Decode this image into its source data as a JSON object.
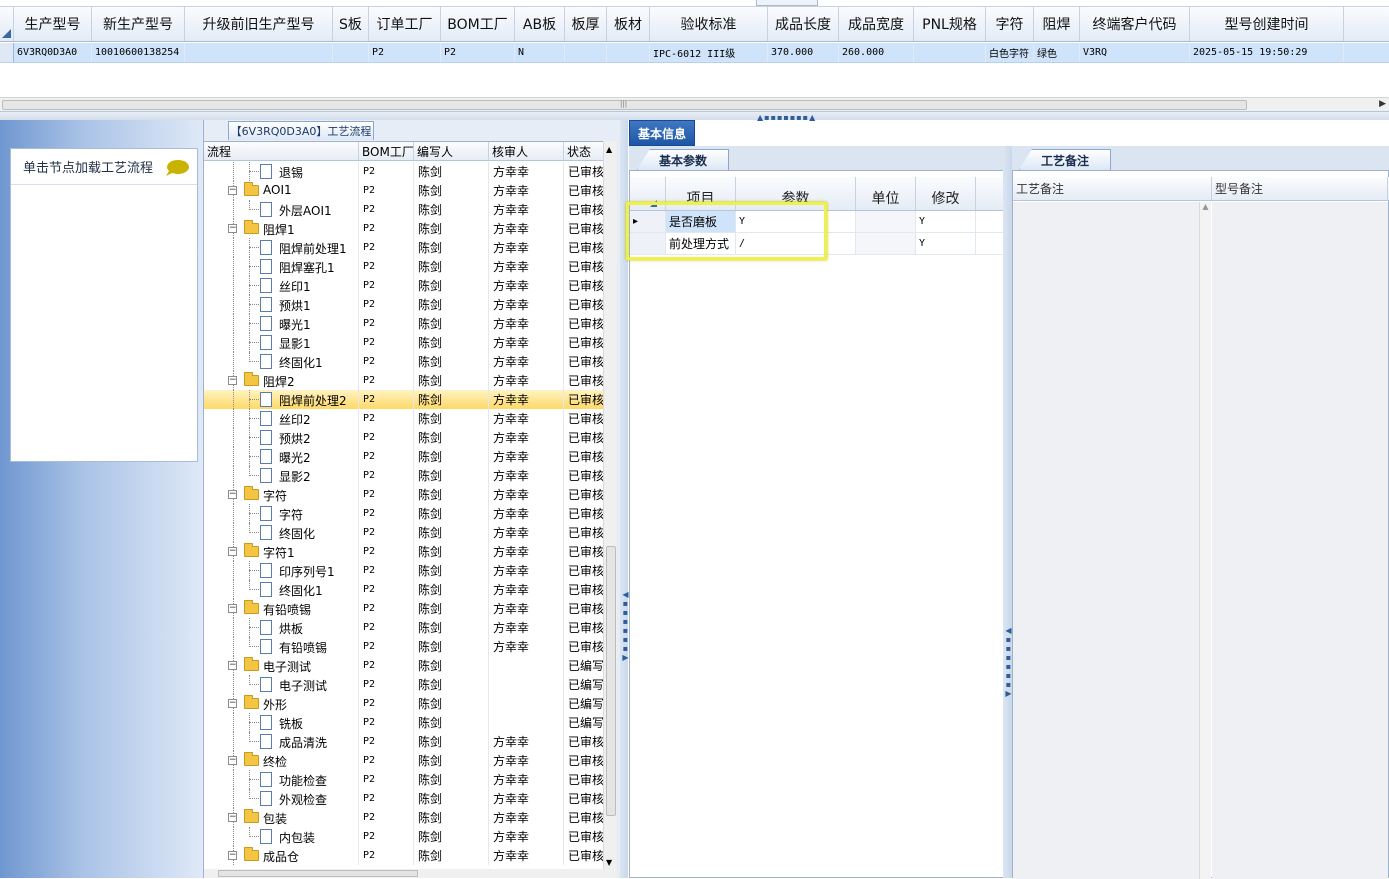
{
  "top_grid": {
    "columns": [
      "生产型号",
      "新生产型号",
      "升级前旧生产型号",
      "S板",
      "订单工厂",
      "BOM工厂",
      "AB板",
      "板厚",
      "板材",
      "验收标准",
      "成品长度",
      "成品宽度",
      "PNL规格",
      "字符",
      "阻焊",
      "终端客户代码",
      "型号创建时间"
    ],
    "row": [
      "6V3RQ0D3A0",
      "10010600138254",
      "",
      "",
      "P2",
      "P2",
      "N",
      "",
      "",
      "IPC-6012 III级",
      "370.000",
      "260.000",
      "",
      "白色字符",
      "绿色",
      "V3RQ",
      "2025-05-15 19:50:29"
    ]
  },
  "left_panel": {
    "hint": "单击节点加载工艺流程"
  },
  "tree": {
    "title": "【6V3RQ0D3A0】工艺流程",
    "columns": [
      "流程",
      "BOM工厂",
      "编写人",
      "核审人",
      "状态"
    ],
    "rows": [
      {
        "name": "退锡",
        "factory": "P2",
        "writer": "陈剑",
        "reviewer": "方幸幸",
        "status": "已审核"
      },
      {
        "name": "AOI1",
        "factory": "P2",
        "writer": "陈剑",
        "reviewer": "方幸幸",
        "status": "已审核"
      },
      {
        "name": "外层AOI1",
        "factory": "P2",
        "writer": "陈剑",
        "reviewer": "方幸幸",
        "status": "已审核"
      },
      {
        "name": "阻焊1",
        "factory": "P2",
        "writer": "陈剑",
        "reviewer": "方幸幸",
        "status": "已审核"
      },
      {
        "name": "阻焊前处理1",
        "factory": "P2",
        "writer": "陈剑",
        "reviewer": "方幸幸",
        "status": "已审核"
      },
      {
        "name": "阻焊塞孔1",
        "factory": "P2",
        "writer": "陈剑",
        "reviewer": "方幸幸",
        "status": "已审核"
      },
      {
        "name": "丝印1",
        "factory": "P2",
        "writer": "陈剑",
        "reviewer": "方幸幸",
        "status": "已审核"
      },
      {
        "name": "预烘1",
        "factory": "P2",
        "writer": "陈剑",
        "reviewer": "方幸幸",
        "status": "已审核"
      },
      {
        "name": "曝光1",
        "factory": "P2",
        "writer": "陈剑",
        "reviewer": "方幸幸",
        "status": "已审核"
      },
      {
        "name": "显影1",
        "factory": "P2",
        "writer": "陈剑",
        "reviewer": "方幸幸",
        "status": "已审核"
      },
      {
        "name": "终固化1",
        "factory": "P2",
        "writer": "陈剑",
        "reviewer": "方幸幸",
        "status": "已审核"
      },
      {
        "name": "阻焊2",
        "factory": "P2",
        "writer": "陈剑",
        "reviewer": "方幸幸",
        "status": "已审核"
      },
      {
        "name": "阻焊前处理2",
        "factory": "P2",
        "writer": "陈剑",
        "reviewer": "方幸幸",
        "status": "已审核"
      },
      {
        "name": "丝印2",
        "factory": "P2",
        "writer": "陈剑",
        "reviewer": "方幸幸",
        "status": "已审核"
      },
      {
        "name": "预烘2",
        "factory": "P2",
        "writer": "陈剑",
        "reviewer": "方幸幸",
        "status": "已审核"
      },
      {
        "name": "曝光2",
        "factory": "P2",
        "writer": "陈剑",
        "reviewer": "方幸幸",
        "status": "已审核"
      },
      {
        "name": "显影2",
        "factory": "P2",
        "writer": "陈剑",
        "reviewer": "方幸幸",
        "status": "已审核"
      },
      {
        "name": "字符",
        "factory": "P2",
        "writer": "陈剑",
        "reviewer": "方幸幸",
        "status": "已审核"
      },
      {
        "name": "字符",
        "factory": "P2",
        "writer": "陈剑",
        "reviewer": "方幸幸",
        "status": "已审核"
      },
      {
        "name": "终固化",
        "factory": "P2",
        "writer": "陈剑",
        "reviewer": "方幸幸",
        "status": "已审核"
      },
      {
        "name": "字符1",
        "factory": "P2",
        "writer": "陈剑",
        "reviewer": "方幸幸",
        "status": "已审核"
      },
      {
        "name": "印序列号1",
        "factory": "P2",
        "writer": "陈剑",
        "reviewer": "方幸幸",
        "status": "已审核"
      },
      {
        "name": "终固化1",
        "factory": "P2",
        "writer": "陈剑",
        "reviewer": "方幸幸",
        "status": "已审核"
      },
      {
        "name": "有铅喷锡",
        "factory": "P2",
        "writer": "陈剑",
        "reviewer": "方幸幸",
        "status": "已审核"
      },
      {
        "name": "烘板",
        "factory": "P2",
        "writer": "陈剑",
        "reviewer": "方幸幸",
        "status": "已审核"
      },
      {
        "name": "有铅喷锡",
        "factory": "P2",
        "writer": "陈剑",
        "reviewer": "方幸幸",
        "status": "已审核"
      },
      {
        "name": "电子测试",
        "factory": "P2",
        "writer": "陈剑",
        "reviewer": "",
        "status": "已编写"
      },
      {
        "name": "电子测试",
        "factory": "P2",
        "writer": "陈剑",
        "reviewer": "",
        "status": "已编写"
      },
      {
        "name": "外形",
        "factory": "P2",
        "writer": "陈剑",
        "reviewer": "",
        "status": "已编写"
      },
      {
        "name": "铣板",
        "factory": "P2",
        "writer": "陈剑",
        "reviewer": "",
        "status": "已编写"
      },
      {
        "name": "成品清洗",
        "factory": "P2",
        "writer": "陈剑",
        "reviewer": "方幸幸",
        "status": "已审核"
      },
      {
        "name": "终检",
        "factory": "P2",
        "writer": "陈剑",
        "reviewer": "方幸幸",
        "status": "已审核"
      },
      {
        "name": "功能检查",
        "factory": "P2",
        "writer": "陈剑",
        "reviewer": "方幸幸",
        "status": "已审核"
      },
      {
        "name": "外观检查",
        "factory": "P2",
        "writer": "陈剑",
        "reviewer": "方幸幸",
        "status": "已审核"
      },
      {
        "name": "包装",
        "factory": "P2",
        "writer": "陈剑",
        "reviewer": "方幸幸",
        "status": "已审核"
      },
      {
        "name": "内包装",
        "factory": "P2",
        "writer": "陈剑",
        "reviewer": "方幸幸",
        "status": "已审核"
      },
      {
        "name": "成品仓",
        "factory": "P2",
        "writer": "陈剑",
        "reviewer": "方幸幸",
        "status": "已审核"
      }
    ]
  },
  "info": {
    "tab": "基本信息",
    "params_tab": "基本参数",
    "params_columns": [
      "项目",
      "参数",
      "单位",
      "修改"
    ],
    "params_rows": [
      {
        "item": "是否磨板",
        "value": "Y",
        "unit": "",
        "modify": "Y"
      },
      {
        "item": "前处理方式",
        "value": "/",
        "unit": "",
        "modify": "Y"
      }
    ],
    "remarks_tab": "工艺备注",
    "remarks_columns": [
      "工艺备注",
      "型号备注"
    ]
  },
  "colors": {
    "highlight": "#f0f04a",
    "selected_row": "#ffd966",
    "header_row": "#cfe4fa",
    "tab_blue": "#1d56a4"
  }
}
